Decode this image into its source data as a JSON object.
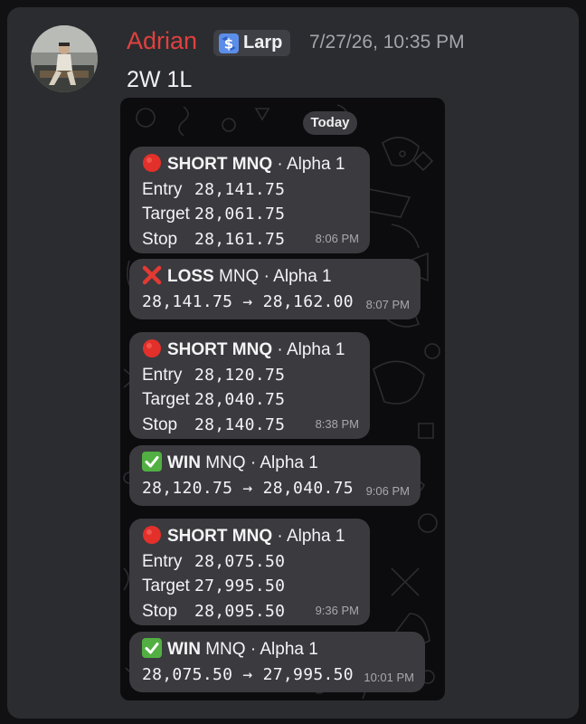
{
  "user": {
    "name": "Adrian",
    "badge": "Larp",
    "timestamp": "7/27/26, 10:35 PM"
  },
  "message": {
    "text": "2W 1L"
  },
  "chat": {
    "date_chip": "Today",
    "signals": [
      {
        "type": "short",
        "header_bold": "SHORT MNQ",
        "header_rest": " · Alpha 1",
        "entry_label": "Entry",
        "entry": "28,141.75",
        "target_label": "Target",
        "target": "28,061.75",
        "stop_label": "Stop",
        "stop": "28,161.75",
        "time": "8:06 PM"
      },
      {
        "type": "loss",
        "header_bold": "LOSS",
        "header_rest": " MNQ · Alpha 1",
        "result": "28,141.75 → 28,162.00",
        "time": "8:07 PM"
      },
      {
        "type": "short",
        "header_bold": "SHORT MNQ",
        "header_rest": " · Alpha 1",
        "entry_label": "Entry",
        "entry": "28,120.75",
        "target_label": "Target",
        "target": "28,040.75",
        "stop_label": "Stop",
        "stop": "28,140.75",
        "time": "8:38 PM"
      },
      {
        "type": "win",
        "header_bold": "WIN",
        "header_rest": " MNQ · Alpha 1",
        "result": "28,120.75 → 28,040.75",
        "time": "9:06 PM"
      },
      {
        "type": "short",
        "header_bold": "SHORT MNQ",
        "header_rest": " · Alpha 1",
        "entry_label": "Entry",
        "entry": "28,075.50",
        "target_label": "Target",
        "target": "27,995.50",
        "stop_label": "Stop",
        "stop": "28,095.50",
        "time": "9:36 PM"
      },
      {
        "type": "win",
        "header_bold": "WIN",
        "header_rest": " MNQ · Alpha 1",
        "result": "28,075.50 → 27,995.50",
        "time": "10:01 PM"
      }
    ]
  },
  "icons": {
    "short": "red-circle-icon",
    "loss": "red-cross-icon",
    "win": "green-check-icon"
  },
  "colors": {
    "username": "#e0413e",
    "card_background": "#2b2c30",
    "bubble_background": "#3a3a3f",
    "short_dot": "#e3302a",
    "loss_cross": "#e23a32",
    "win_check": "#52b043"
  }
}
